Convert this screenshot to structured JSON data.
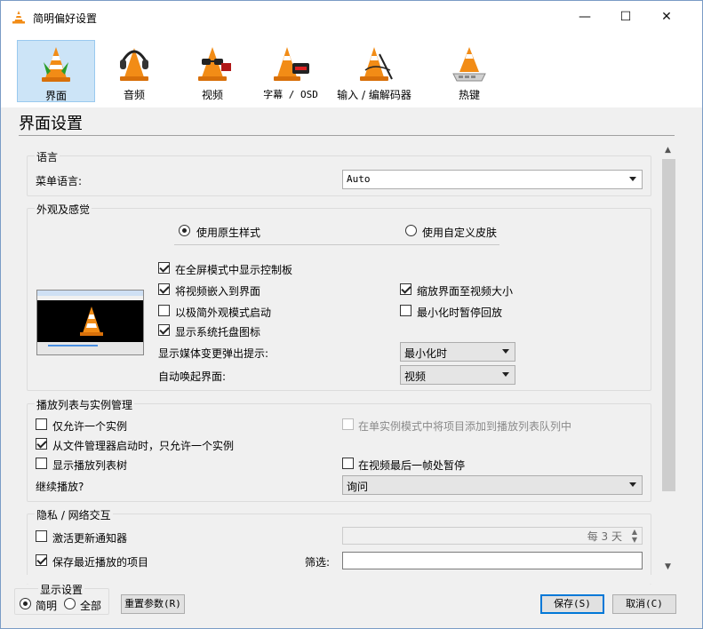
{
  "window": {
    "title": "简明偏好设置",
    "minimize_glyph": "—",
    "maximize_glyph": "☐",
    "close_glyph": "✕"
  },
  "toolbar": {
    "items": [
      {
        "label": "界面",
        "icon": "interface-cone-icon",
        "selected": true
      },
      {
        "label": "音频",
        "icon": "audio-cone-headphones-icon"
      },
      {
        "label": "视频",
        "icon": "video-cone-glasses-icon"
      },
      {
        "label": "字幕 / OSD",
        "icon": "subtitles-cone-clock-icon"
      },
      {
        "label": "输入 / 编解码器",
        "icon": "input-codecs-cone-icon"
      },
      {
        "label": "热键",
        "icon": "hotkeys-cone-keyboard-icon"
      }
    ]
  },
  "page_title": "界面设置",
  "language": {
    "group_title": "语言",
    "menu_language_label": "菜单语言:",
    "menu_language_value": "Auto"
  },
  "look": {
    "group_title": "外观及感觉",
    "radio_native": "使用原生样式",
    "radio_custom": "使用自定义皮肤",
    "native_selected": true,
    "fullscreen_controls": "在全屏模式中显示控制板",
    "embed_video": "将视频嵌入到界面",
    "minimal_start": "以极简外观模式启动",
    "systray": "显示系统托盘图标",
    "resize_to_video": "缩放界面至视频大小",
    "pause_minimized": "最小化时暂停回放",
    "popup_label": "显示媒体变更弹出提示:",
    "popup_value": "最小化时",
    "raise_label": "自动唤起界面:",
    "raise_value": "视频",
    "checks": {
      "fullscreen_controls": true,
      "embed_video": true,
      "minimal_start": false,
      "systray": true,
      "resize_to_video": true,
      "pause_minimized": false
    }
  },
  "playlist": {
    "group_title": "播放列表与实例管理",
    "one_instance": "仅允许一个实例",
    "enqueue_one_instance": "在单实例模式中将项目添加到播放列表队列中",
    "file_manager_one_instance": "从文件管理器启动时，只允许一个实例",
    "show_playlist_tree": "显示播放列表树",
    "pause_last_frame": "在视频最后一帧处暂停",
    "resume_label": "继续播放?",
    "resume_value": "询问",
    "checks": {
      "one_instance": false,
      "enqueue_one_instance": false,
      "file_manager_one_instance": true,
      "show_playlist_tree": false,
      "pause_last_frame": false
    }
  },
  "privacy": {
    "group_title": "隐私 / 网络交互",
    "update_notifier": "激活更新通知器",
    "update_interval": "每 3 天",
    "save_recent": "保存最近播放的项目",
    "filter_label": "筛选:",
    "filter_value": "",
    "checks": {
      "update_notifier": false,
      "save_recent": true
    }
  },
  "footer": {
    "display_group_title": "显示设置",
    "simple_label": "简明",
    "all_label": "全部",
    "simple_selected": true,
    "reset_button": "重置参数(R)",
    "save_button": "保存(S)",
    "cancel_button": "取消(C)"
  },
  "colors": {
    "accent": "#0078d7",
    "selected_tab_bg": "#cce4f7",
    "cone_orange": "#f28c16"
  }
}
